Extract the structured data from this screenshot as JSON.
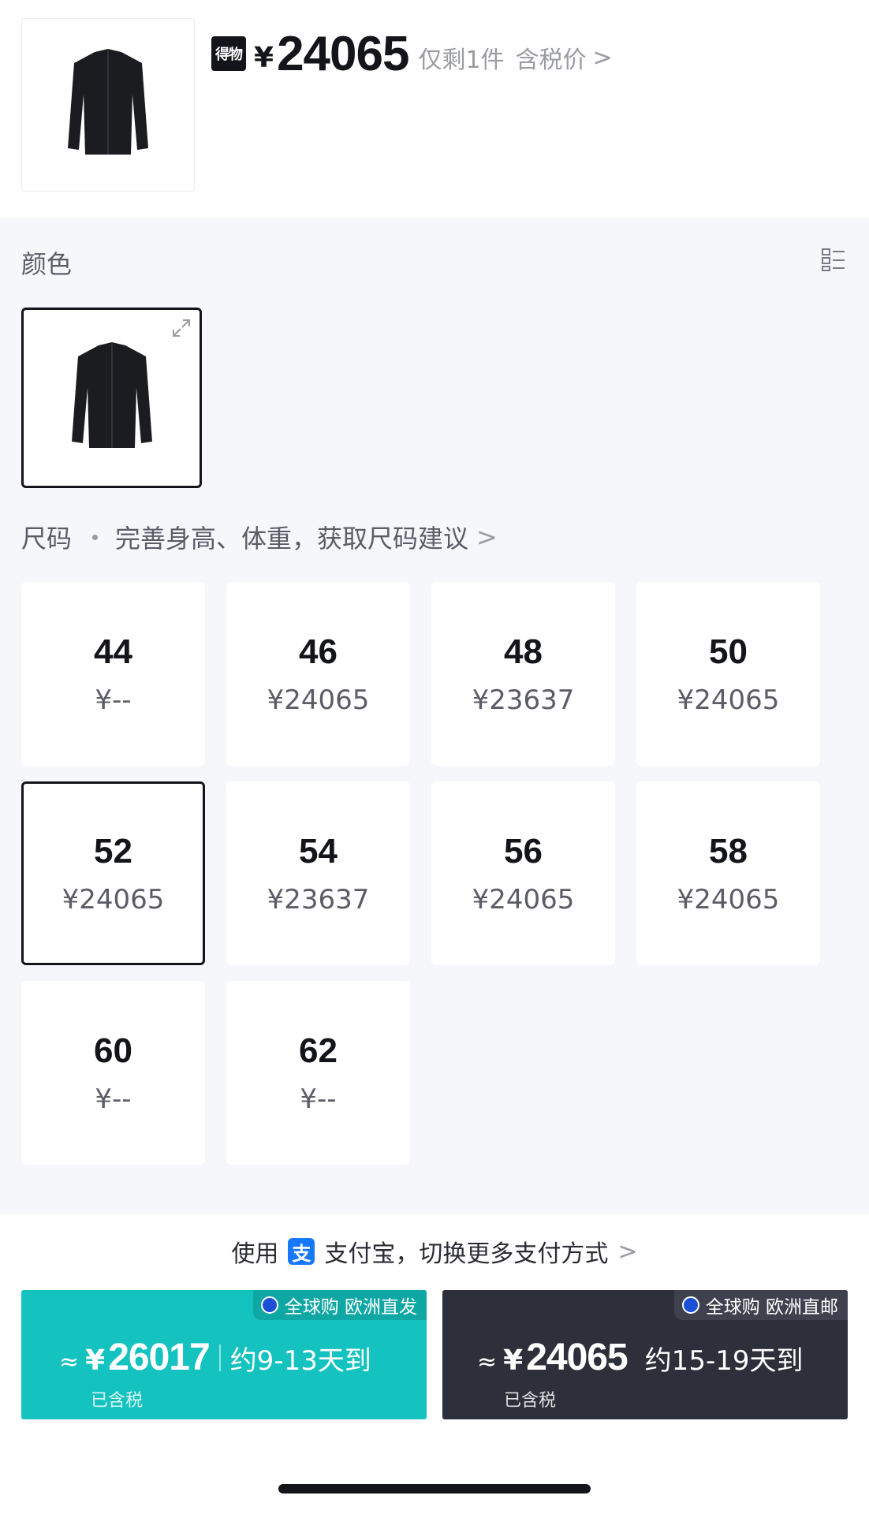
{
  "header": {
    "brand_logo": "得物",
    "currency": "¥",
    "price": "24065",
    "stock": "仅剩1件",
    "tax": "含税价",
    "tax_chevron": ">"
  },
  "color_section": {
    "label": "颜色"
  },
  "size_section": {
    "label": "尺码",
    "hint": "完善身高、体重，获取尺码建议",
    "chevron": ">",
    "sizes": [
      {
        "size": "44",
        "price": "¥--"
      },
      {
        "size": "46",
        "price": "¥24065"
      },
      {
        "size": "48",
        "price": "¥23637"
      },
      {
        "size": "50",
        "price": "¥24065"
      },
      {
        "size": "52",
        "price": "¥24065",
        "selected": true
      },
      {
        "size": "54",
        "price": "¥23637"
      },
      {
        "size": "56",
        "price": "¥24065"
      },
      {
        "size": "58",
        "price": "¥24065"
      },
      {
        "size": "60",
        "price": "¥--"
      },
      {
        "size": "62",
        "price": "¥--"
      }
    ]
  },
  "payment": {
    "prefix": "使用",
    "alipay_glyph": "支",
    "text": "支付宝，切换更多支付方式",
    "chevron": ">"
  },
  "buttons": {
    "left": {
      "tag": "全球购 欧洲直发",
      "approx": "≈",
      "currency": "¥",
      "price": "26017",
      "days": "约9-13天到",
      "sub": "已含税"
    },
    "right": {
      "tag": "全球购 欧洲直邮",
      "approx": "≈",
      "currency": "¥",
      "price": "24065",
      "days": "约15-19天到",
      "sub": "已含税"
    }
  },
  "colors": {
    "accent_teal": "#14c2bf",
    "dark_button": "#2d2f3a",
    "text_primary": "#14151a",
    "text_muted": "#9a9ba3",
    "alipay_blue": "#1677ff"
  },
  "icons": [
    "jacket-thumbnail-icon",
    "list-view-icon",
    "expand-icon",
    "alipay-icon",
    "eu-flag-icon",
    "chevron-right-icon"
  ]
}
